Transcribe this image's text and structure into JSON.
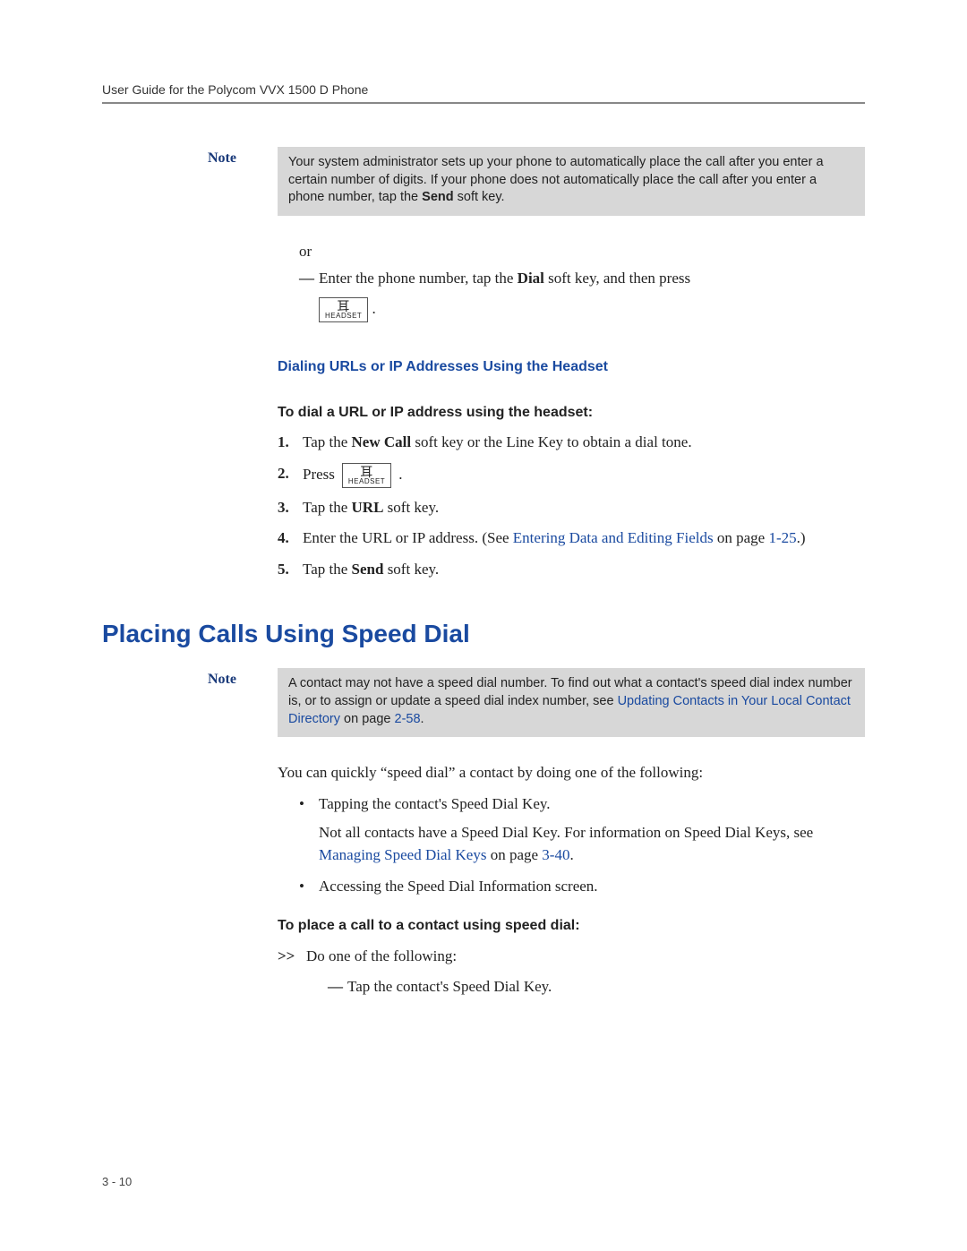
{
  "header": "User Guide for the Polycom VVX 1500 D Phone",
  "note1": {
    "label": "Note",
    "text_pre": "Your system administrator sets up your phone to automatically place the call after you enter a certain number of digits. If your phone does not automatically place the call after you enter a phone number, tap the ",
    "send_word": "Send",
    "text_post": " soft key."
  },
  "or_word": "or",
  "dash1_pre": "Enter the phone number, tap the ",
  "dash1_bold": "Dial",
  "dash1_post": " soft key, and then press",
  "headset_label": "HEADSET",
  "sub_blue": "Dialing URLs or IP Addresses Using the Headset",
  "sub_black1": "To dial a URL or IP address using the headset:",
  "steps": {
    "s1_pre": "Tap the ",
    "s1_b": "New Call",
    "s1_post": " soft key or the Line Key to obtain a dial tone.",
    "s2_pre": "Press ",
    "s2_post": " .",
    "s3_pre": "Tap the ",
    "s3_b": "URL",
    "s3_post": " soft key.",
    "s4_pre": "Enter the URL or IP address. (See ",
    "s4_link": "Entering Data and Editing Fields",
    "s4_mid": " on page ",
    "s4_pg": "1-25",
    "s4_post": ".)",
    "s5_pre": "Tap the ",
    "s5_b": "Send",
    "s5_post": " soft key."
  },
  "h2": "Placing Calls Using Speed Dial",
  "note2": {
    "label": "Note",
    "text_pre": "A contact may not have a speed dial number. To find out what a contact's speed dial index number is, or to assign or update a speed dial index number, see ",
    "link": "Updating Contacts in Your Local Contact Directory",
    "mid": " on page ",
    "pg": "2-58",
    "post": "."
  },
  "para_intro": "You can quickly “speed dial” a contact by doing one of the following:",
  "bullet1_a": "Tapping the contact's Speed Dial Key.",
  "bullet1_b_pre": "Not all contacts have a Speed Dial Key. For information on Speed Dial Keys, see ",
  "bullet1_b_link": "Managing Speed Dial Keys",
  "bullet1_b_mid": " on page ",
  "bullet1_b_pg": "3-40",
  "bullet1_b_post": ".",
  "bullet2": "Accessing the Speed Dial Information screen.",
  "sub_black2": "To place a call to a contact using speed dial:",
  "chev_text": "Do one of the following:",
  "dash2": "Tap the contact's Speed Dial Key.",
  "page_num": "3 - 10",
  "nums": {
    "n1": "1.",
    "n2": "2.",
    "n3": "3.",
    "n4": "4.",
    "n5": "5."
  },
  "chev_sym": ">>",
  "dash_sym": "—",
  "bullet_sym": "•"
}
